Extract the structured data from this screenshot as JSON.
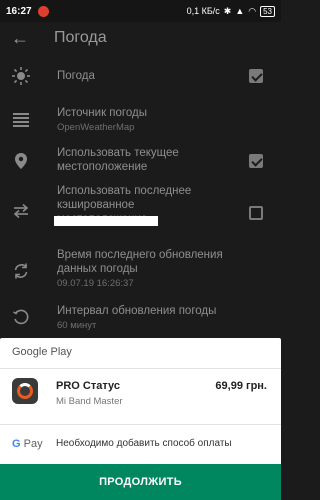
{
  "statusbar": {
    "time": "16:27",
    "net": "0,1 КБ/с",
    "battery": "53"
  },
  "appbar": {
    "title": "Погода"
  },
  "settings": [
    {
      "label": "Погода",
      "checked": true
    },
    {
      "label": "Источник погоды",
      "sub": "OpenWeatherMap"
    },
    {
      "label": "Использовать текущее местоположение",
      "checked": true
    },
    {
      "label": "Использовать последнее кэшированное местоположение",
      "checked": false
    },
    {
      "label": "Время последнего обновления данных погоды",
      "sub": "09.07.19 16:26:37"
    },
    {
      "label": "Интервал обновления погоды",
      "sub": "60 минут"
    }
  ],
  "sheet": {
    "header": "Google Play",
    "product_name": "PRO Статус",
    "developer": "Mi Band Master",
    "price": "69,99 грн.",
    "gpay_label": "Pay",
    "gpay_g": "G",
    "payment_message": "Необходимо добавить способ оплаты",
    "continue_label": "ПРОДОЛЖИТЬ"
  },
  "colors": {
    "accent": "#01875f",
    "checkbox": "#7a7a7a"
  }
}
